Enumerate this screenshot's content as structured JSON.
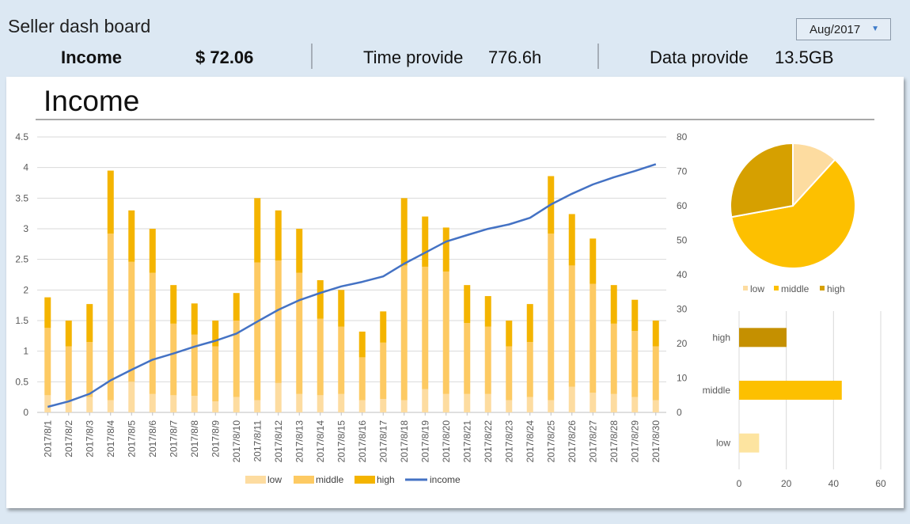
{
  "header": {
    "title": "Seller dash board",
    "period": {
      "value": "Aug/2017",
      "arrow": "▼"
    },
    "income": {
      "label": "Income",
      "value": "$ 72.06"
    },
    "time": {
      "label": "Time provide",
      "value": "776.6h"
    },
    "data": {
      "label": "Data provide",
      "value": "13.5GB"
    }
  },
  "section": {
    "title": "Income"
  },
  "colors": {
    "low": "#fddca0",
    "middle": "#fdca63",
    "high": "#f4b400",
    "income": "#4472c4"
  },
  "chart_data": [
    {
      "type": "bar",
      "stacked": true,
      "categories": [
        "2017/8/1",
        "2017/8/2",
        "2017/8/3",
        "2017/8/4",
        "2017/8/5",
        "2017/8/6",
        "2017/8/7",
        "2017/8/8",
        "2017/8/9",
        "2017/8/10",
        "2017/8/11",
        "2017/8/12",
        "2017/8/13",
        "2017/8/14",
        "2017/8/15",
        "2017/8/16",
        "2017/8/17",
        "2017/8/18",
        "2017/8/19",
        "2017/8/20",
        "2017/8/21",
        "2017/8/22",
        "2017/8/23",
        "2017/8/24",
        "2017/8/25",
        "2017/8/26",
        "2017/8/27",
        "2017/8/28",
        "2017/8/29",
        "2017/8/30"
      ],
      "series": [
        {
          "name": "low",
          "axis": "left",
          "values": [
            0.28,
            0.2,
            0.25,
            0.2,
            0.5,
            0.3,
            0.28,
            0.27,
            0.18,
            0.25,
            0.2,
            0.48,
            0.3,
            0.28,
            0.3,
            0.2,
            0.22,
            0.2,
            0.38,
            0.3,
            0.3,
            0.3,
            0.2,
            0.25,
            0.2,
            0.42,
            0.32,
            0.3,
            0.25,
            0.2
          ]
        },
        {
          "name": "middle",
          "axis": "left",
          "values": [
            1.1,
            0.88,
            0.9,
            2.72,
            1.96,
            1.98,
            1.17,
            1.0,
            0.9,
            1.25,
            2.25,
            2.0,
            1.98,
            1.25,
            1.1,
            0.7,
            0.92,
            2.2,
            2.0,
            2.0,
            1.16,
            1.1,
            0.88,
            0.9,
            2.72,
            1.98,
            1.78,
            1.15,
            1.08,
            0.88
          ]
        },
        {
          "name": "high",
          "axis": "left",
          "values": [
            0.5,
            0.42,
            0.62,
            1.03,
            0.84,
            0.72,
            0.63,
            0.51,
            0.42,
            0.45,
            1.05,
            0.82,
            0.72,
            0.63,
            0.6,
            0.42,
            0.51,
            1.1,
            0.82,
            0.72,
            0.62,
            0.5,
            0.42,
            0.62,
            0.94,
            0.84,
            0.74,
            0.63,
            0.51,
            0.42
          ]
        },
        {
          "name": "income",
          "type": "line",
          "axis": "right",
          "values": [
            1.6,
            3.2,
            5.4,
            9.3,
            12.4,
            15.3,
            17.1,
            19.1,
            20.8,
            22.9,
            26.4,
            29.8,
            32.6,
            34.7,
            36.6,
            37.9,
            39.5,
            43.2,
            46.4,
            49.6,
            51.5,
            53.3,
            54.6,
            56.5,
            60.4,
            63.5,
            66.2,
            68.3,
            70.1,
            72.1
          ]
        }
      ],
      "y_left": {
        "min": 0,
        "max": 4.5,
        "ticks": [
          "0",
          "0.5",
          "1",
          "1.5",
          "2",
          "2.5",
          "3",
          "3.5",
          "4",
          "4.5"
        ]
      },
      "y_right": {
        "min": 0,
        "max": 80,
        "ticks": [
          "0",
          "10",
          "20",
          "30",
          "40",
          "50",
          "60",
          "70",
          "80"
        ]
      },
      "legend": [
        "low",
        "middle",
        "high",
        "income"
      ],
      "grid": true,
      "legend_position": "bottom"
    },
    {
      "type": "pie",
      "labels": [
        "low",
        "middle",
        "high"
      ],
      "values": [
        8.5,
        43.5,
        20.1
      ],
      "colors": [
        "#fddca0",
        "#fdc000",
        "#d6a000"
      ],
      "legend": [
        "low",
        "middle",
        "high"
      ],
      "legend_position": "bottom"
    },
    {
      "type": "bar",
      "orientation": "horizontal",
      "categories": [
        "high",
        "middle",
        "low"
      ],
      "values": [
        20.1,
        43.5,
        8.5
      ],
      "colors": [
        "#c59000",
        "#fdc000",
        "#fde4a0"
      ],
      "xlim": [
        0,
        60
      ],
      "x_ticks": [
        "0",
        "20",
        "40",
        "60"
      ],
      "grid": true
    }
  ]
}
